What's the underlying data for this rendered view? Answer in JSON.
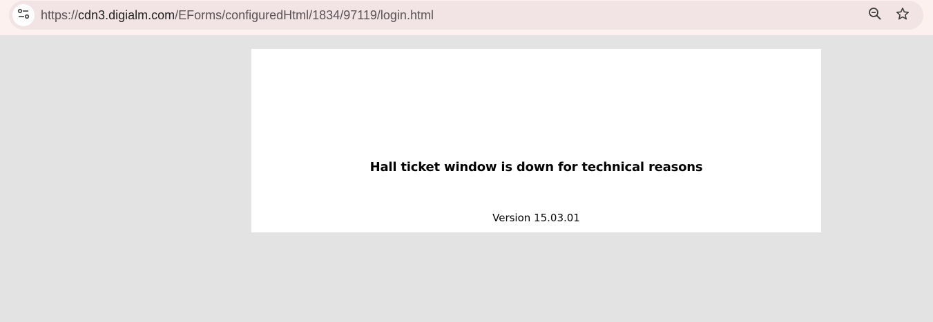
{
  "browser": {
    "url_scheme": "https://",
    "url_host": "cdn3.digialm.com",
    "url_path": "/EForms/configuredHtml/1834/97119/login.html",
    "icons": {
      "site_info": "tune-icon",
      "zoom": "zoom-out-icon",
      "bookmark": "star-icon"
    }
  },
  "page": {
    "message": "Hall ticket window is down for technical reasons",
    "version": "Version 15.03.01"
  },
  "colors": {
    "page_background": "#e3e3e3",
    "card_background": "#ffffff",
    "toolbar_background": "#fdf1f0",
    "omnibox_background": "#f2e3e5"
  }
}
